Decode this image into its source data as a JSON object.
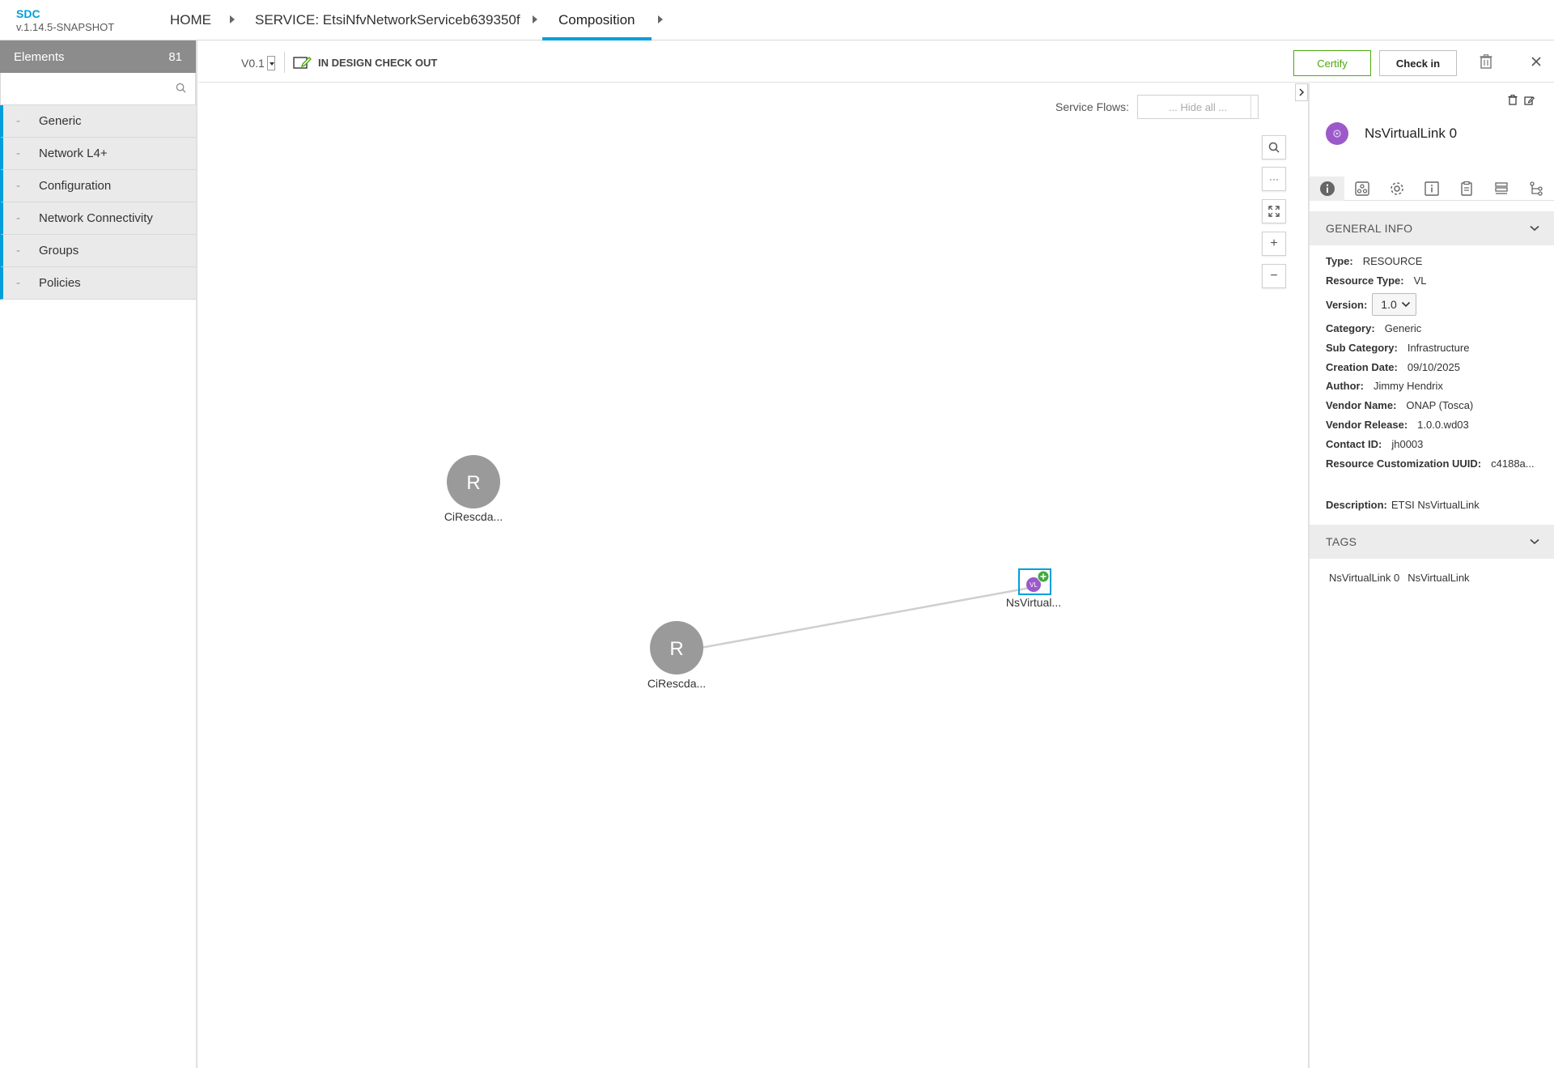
{
  "app": {
    "name": "SDC",
    "version": "v.1.14.5-SNAPSHOT"
  },
  "breadcrumb": {
    "home": "HOME",
    "service": "SERVICE: EtsiNfvNetworkServiceb639350f",
    "current": "Composition"
  },
  "palette": {
    "title": "Elements",
    "count": "81",
    "search_placeholder": "",
    "categories": [
      "Generic",
      "Network L4+",
      "Configuration",
      "Network Connectivity",
      "Groups",
      "Policies"
    ],
    "dash": "-"
  },
  "toolbar": {
    "version": "V0.1",
    "status": "IN DESIGN CHECK OUT",
    "certify": "Certify",
    "checkin": "Check in"
  },
  "canvas": {
    "service_flows_label": "Service Flows:",
    "service_flows_value": "... Hide all ...",
    "zoom": {
      "more": "···",
      "plus": "+",
      "minus": "−"
    },
    "nodes": [
      {
        "letter": "R",
        "label": "CiRescda..."
      },
      {
        "letter": "R",
        "label": "CiRescda..."
      },
      {
        "letter": "VL",
        "label": "NsVirtual..."
      }
    ]
  },
  "right_panel": {
    "title": "NsVirtualLink 0",
    "general_info_title": "GENERAL INFO",
    "info": {
      "type_label": "Type:",
      "type": "RESOURCE",
      "resource_type_label": "Resource Type:",
      "resource_type": "VL",
      "version_label": "Version:",
      "version": "1.0",
      "category_label": "Category:",
      "category": "Generic",
      "subcategory_label": "Sub Category:",
      "subcategory": "Infrastructure",
      "creation_date_label": "Creation Date:",
      "creation_date": "09/10/2025",
      "author_label": "Author:",
      "author": "Jimmy Hendrix",
      "vendor_name_label": "Vendor Name:",
      "vendor_name": "ONAP (Tosca)",
      "vendor_release_label": "Vendor Release:",
      "vendor_release": "1.0.0.wd03",
      "contact_id_label": "Contact ID:",
      "contact_id": "jh0003",
      "uuid_label": "Resource Customization UUID:",
      "uuid": "c4188a...",
      "description_label": "Description:",
      "description": "ETSI NsVirtualLink"
    },
    "tags_title": "TAGS",
    "tags": [
      "NsVirtualLink 0",
      "NsVirtualLink"
    ]
  },
  "colors": {
    "accent": "#009fdb",
    "certify": "#4ca90c",
    "vl_node": "#9b59c9",
    "resource_node": "#9a9a9a"
  }
}
